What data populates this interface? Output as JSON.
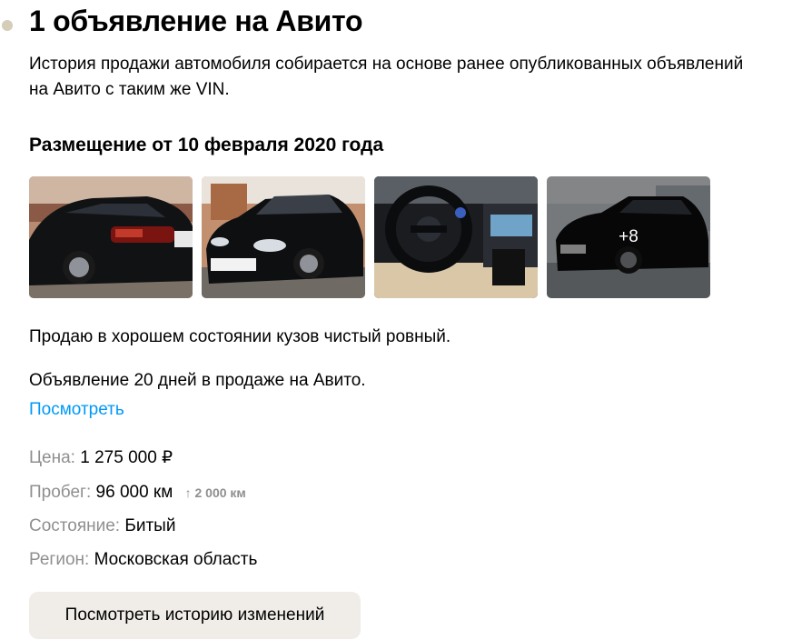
{
  "header": {
    "title": "1 объявление на Авито",
    "subtitle": "История продажи автомобиля собирается на основе ранее опубликованных объявлений на Авито с таким же VIN."
  },
  "listing": {
    "heading": "Размещение от 10 февраля 2020 года",
    "photos": [
      {
        "icon": "car-rear-photo"
      },
      {
        "icon": "car-front-photo"
      },
      {
        "icon": "car-interior-photo"
      },
      {
        "icon": "car-side-photo",
        "more_label": "+8"
      }
    ],
    "description": "Продаю в хорошем состоянии кузов чистый ровный.",
    "days_text": "Объявление 20 дней в продаже на Авито.",
    "view_link": "Посмотреть",
    "price": {
      "label": "Цена:",
      "value": "1 275 000 ₽"
    },
    "mileage": {
      "label": "Пробег:",
      "value": "96 000 км",
      "delta": "↑ 2 000 км"
    },
    "condition": {
      "label": "Состояние:",
      "value": "Битый"
    },
    "region": {
      "label": "Регион:",
      "value": "Московская область"
    },
    "history_button": "Посмотреть историю изменений"
  },
  "colors": {
    "bullet": "#d3cdb9",
    "link": "#0099f7",
    "muted": "#8f8f8f",
    "button_bg": "#f0ede9"
  }
}
